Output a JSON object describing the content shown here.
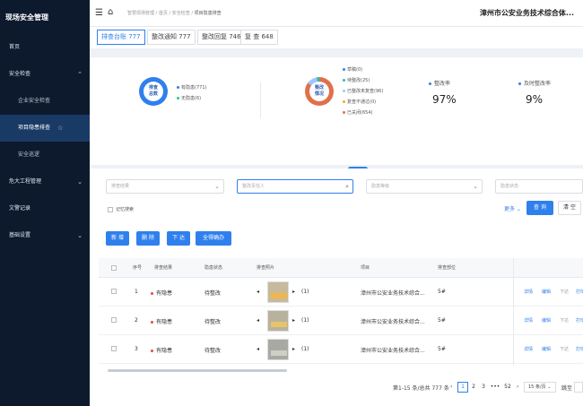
{
  "sidebar": {
    "brand": "现场安全管理",
    "items": [
      {
        "label": "首页"
      },
      {
        "label": "安全检查"
      },
      {
        "label": "企业安全检查"
      },
      {
        "label": "项目隐患排查"
      },
      {
        "label": "安全巡逻"
      },
      {
        "label": "危大工程管理"
      },
      {
        "label": "文警记录"
      },
      {
        "label": "基础设置"
      }
    ]
  },
  "topbar": {
    "crumbs": [
      "智慧现场管理",
      "首页",
      "安全检查",
      "项目隐患排查"
    ],
    "org": "漳州市公安业务技术综合体..."
  },
  "tabs": [
    {
      "label": "排查台账 777"
    },
    {
      "label": "整改通知 777"
    },
    {
      "label": "整改回复 746"
    },
    {
      "label": "复 查 648"
    }
  ],
  "stats": {
    "donut1": {
      "label_line1": "排查",
      "label_line2": "总数",
      "legend": [
        {
          "label": "有隐患(771)",
          "color": "#2f80ed"
        },
        {
          "label": "无隐患(6)",
          "color": "#27c1a8"
        }
      ]
    },
    "donut2": {
      "label_line1": "整改",
      "label_line2": "情况",
      "legend": [
        {
          "label": "草稿(0)",
          "color": "#2f80ed"
        },
        {
          "label": "待整改(25)",
          "color": "#27c1a8"
        },
        {
          "label": "已整改未复查(96)",
          "color": "#a0c4ff"
        },
        {
          "label": "复查不通过(0)",
          "color": "#f5a623"
        },
        {
          "label": "已关闭(654)",
          "color": "#e0704a"
        }
      ]
    },
    "rate": {
      "title": "整改率",
      "value": "97%"
    },
    "ontime": {
      "title": "及时整改率",
      "value": "9%"
    }
  },
  "filters": {
    "f1": "排查结果",
    "f2": "整改责任人",
    "f3": "隐患等级",
    "f4": "隐患状态",
    "remember": "记忆搜索",
    "more": "更多",
    "query": "查 询",
    "reset": "清 空"
  },
  "actions": {
    "add": "新 增",
    "delete": "删 除",
    "issue": "下 达",
    "batch": "全得确办"
  },
  "table": {
    "headers": [
      "序号",
      "排查结果",
      "隐患状态",
      "排查照片",
      "项目",
      "排查部位"
    ],
    "rows": [
      {
        "no": "1",
        "result": "有隐患",
        "status": "待整改",
        "photos": "(1)",
        "project": "漳州市公安业务技术综合...",
        "part": "5#"
      },
      {
        "no": "2",
        "result": "有隐患",
        "status": "待整改",
        "photos": "(1)",
        "project": "漳州市公安业务技术综合...",
        "part": "5#"
      },
      {
        "no": "3",
        "result": "有隐患",
        "status": "待整改",
        "photos": "(1)",
        "project": "漳州市公安业务技术综合...",
        "part": "5#"
      }
    ],
    "row_actions": {
      "detail": "详情",
      "edit": "编辑",
      "issue": "下达",
      "print": "打印"
    }
  },
  "pagination": {
    "summary": "第1-15 条/总共 777 条",
    "pages": [
      "1",
      "2",
      "3",
      "•••",
      "52"
    ],
    "size": "15 条/页",
    "jump": "跳至"
  }
}
